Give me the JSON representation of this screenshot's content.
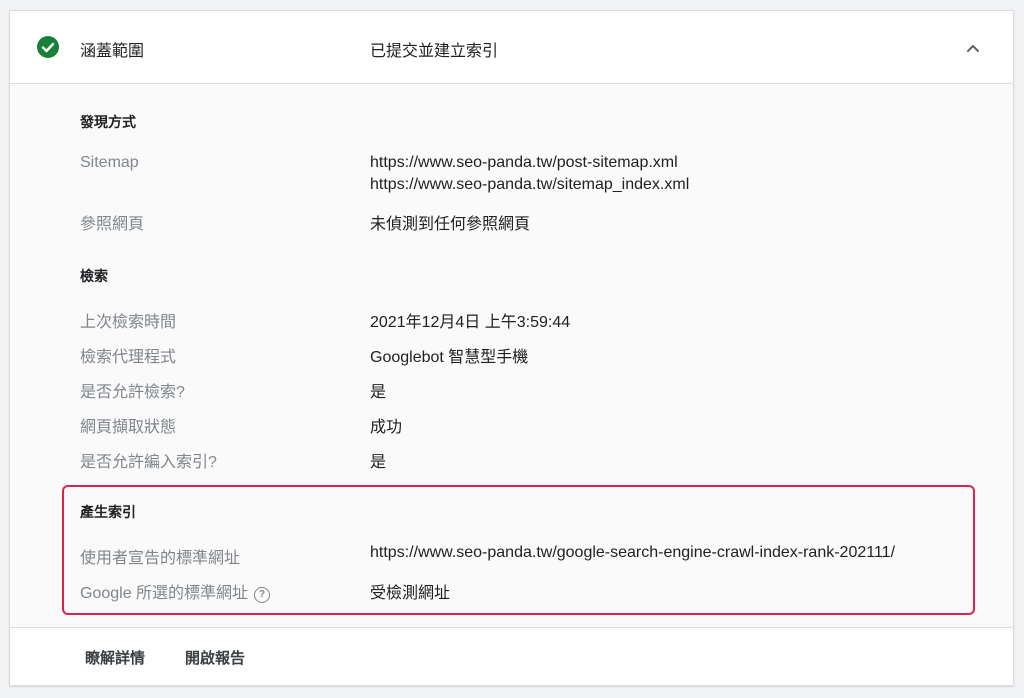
{
  "header": {
    "label": "涵蓋範圍",
    "status": "已提交並建立索引"
  },
  "discovery": {
    "title": "發現方式",
    "sitemap_label": "Sitemap",
    "sitemap_urls": [
      "https://www.seo-panda.tw/post-sitemap.xml",
      "https://www.seo-panda.tw/sitemap_index.xml"
    ],
    "referring_label": "參照網頁",
    "referring_value": "未偵測到任何參照網頁"
  },
  "crawl": {
    "title": "檢索",
    "rows": [
      {
        "label": "上次檢索時間",
        "value": "2021年12月4日 上午3:59:44"
      },
      {
        "label": "檢索代理程式",
        "value": "Googlebot 智慧型手機"
      },
      {
        "label": "是否允許檢索?",
        "value": "是"
      },
      {
        "label": "網頁擷取狀態",
        "value": "成功"
      },
      {
        "label": "是否允許編入索引?",
        "value": "是"
      }
    ]
  },
  "indexing": {
    "title": "產生索引",
    "user_canonical_label": "使用者宣告的標準網址",
    "user_canonical_value": "https://www.seo-panda.tw/google-search-engine-crawl-index-rank-202111/",
    "google_canonical_label": "Google 所選的標準網址",
    "google_canonical_value": "受檢測網址"
  },
  "footer": {
    "learn_more": "瞭解詳情",
    "open_report": "開啟報告"
  },
  "colors": {
    "success": "#188038",
    "highlight_border": "#e0234e"
  }
}
